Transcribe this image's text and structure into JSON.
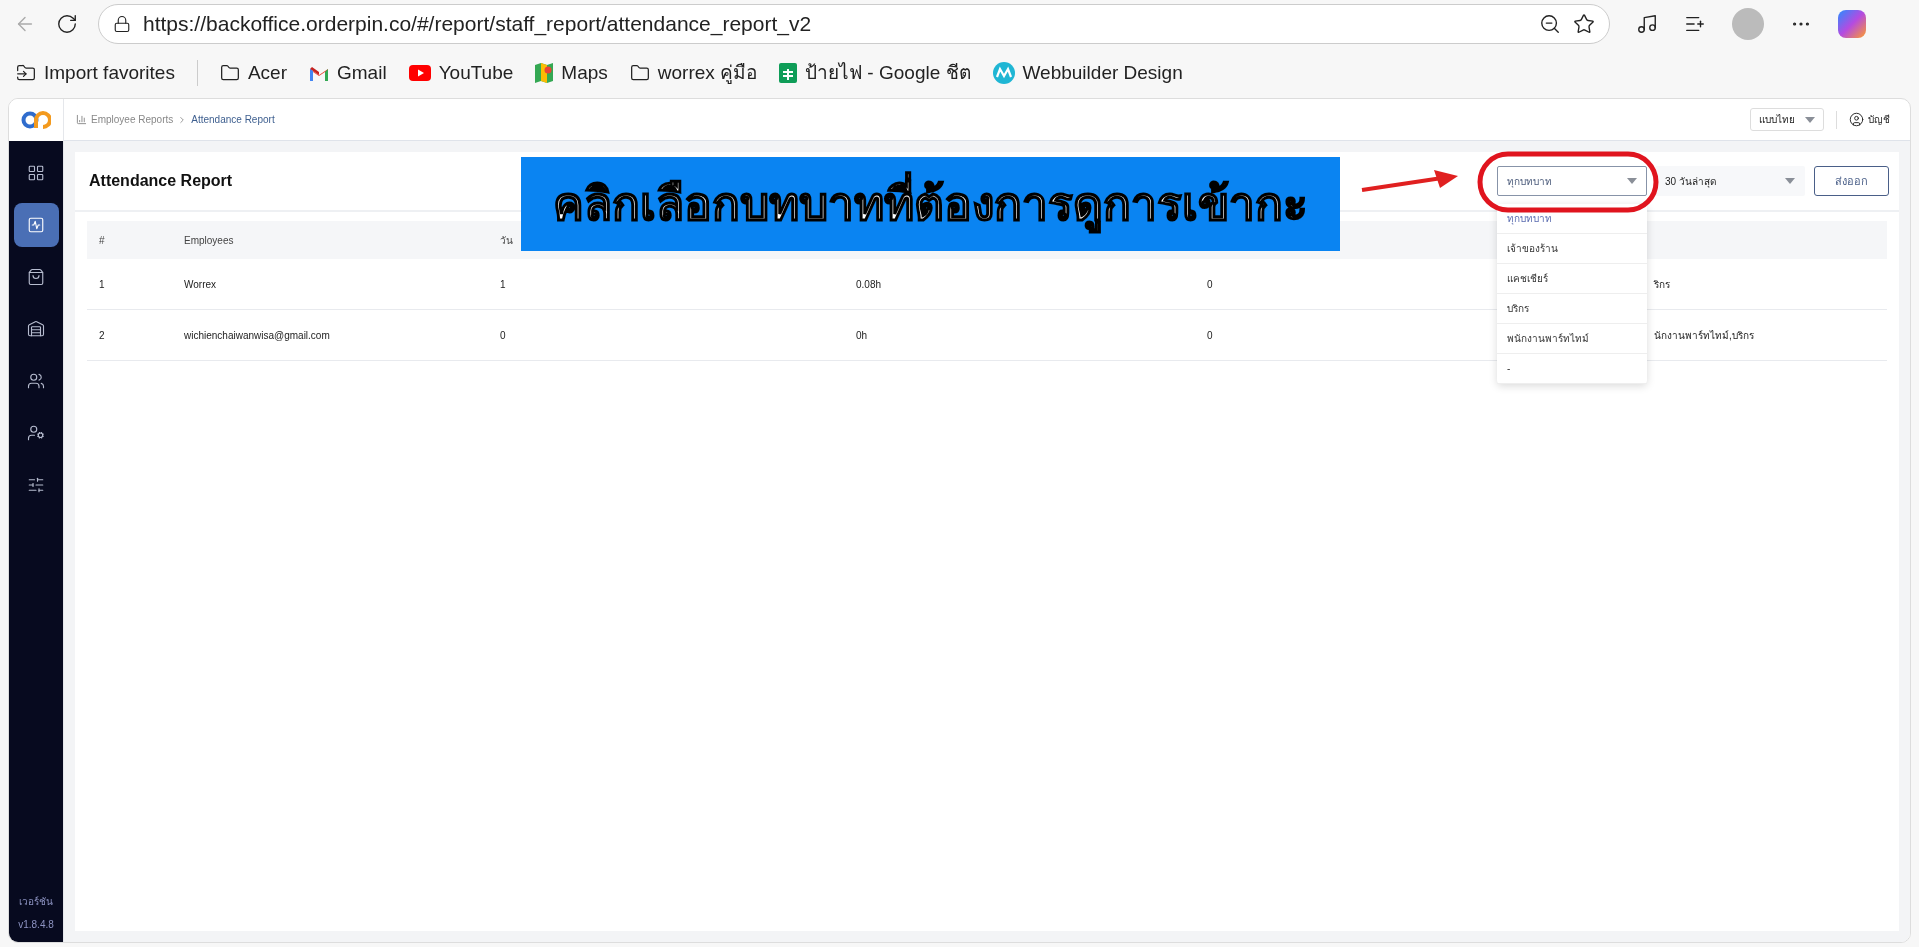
{
  "browser": {
    "url": "https://backoffice.orderpin.co/#/report/staff_report/attendance_report_v2",
    "bookmarks": [
      {
        "label": "Import favorites",
        "kind": "import"
      },
      {
        "label": "Acer",
        "kind": "folder"
      },
      {
        "label": "Gmail",
        "kind": "gmail"
      },
      {
        "label": "YouTube",
        "kind": "youtube"
      },
      {
        "label": "Maps",
        "kind": "maps"
      },
      {
        "label": "worrex คู่มือ",
        "kind": "folder"
      },
      {
        "label": "ป้ายไฟ - Google ชีต",
        "kind": "sheets"
      },
      {
        "label": "Webbuilder Design",
        "kind": "webbuilder"
      }
    ]
  },
  "sidebar": {
    "items": [
      {
        "kind": "grid",
        "selected": false
      },
      {
        "kind": "activity",
        "selected": true
      },
      {
        "kind": "bag",
        "selected": false
      },
      {
        "kind": "warehouse",
        "selected": false
      },
      {
        "kind": "users",
        "selected": false
      },
      {
        "kind": "user-settings",
        "selected": false
      },
      {
        "kind": "sliders",
        "selected": false
      }
    ],
    "version_label": "เวอร์ชัน",
    "version": "v1.8.4.8"
  },
  "breadcrumb": [
    "Employee Reports",
    "Attendance Report"
  ],
  "language_select": {
    "value": "แบบไทย"
  },
  "account": {
    "label": "บัญชี"
  },
  "page": {
    "title": "Attendance Report",
    "role_select": {
      "value": "ทุกบทบาท",
      "expanded": true,
      "options": [
        {
          "label": "ทุกบทบาท",
          "selected": true
        },
        {
          "label": "เจ้าของร้าน",
          "selected": false
        },
        {
          "label": "แคชเชียร์",
          "selected": false
        },
        {
          "label": "บริกร",
          "selected": false
        },
        {
          "label": "พนักงานพาร์ทไทม์",
          "selected": false
        },
        {
          "label": "-",
          "selected": false
        }
      ]
    },
    "period_select": {
      "value": "30 วันล่าสุด"
    },
    "export_button": "ส่งออก"
  },
  "table": {
    "columns": [
      "#",
      "Employees",
      "วัน"
    ],
    "rows": [
      [
        "1",
        "Worrex",
        "1",
        "0.08h",
        "0",
        "ริกร"
      ],
      [
        "2",
        "wichienchaiwanwisa@gmail.com",
        "0",
        "0h",
        "0",
        "นักงานพาร์ทไทม์,บริกร"
      ]
    ]
  },
  "annotation": {
    "text": "คลิกเลือกบทบาทที่ต้องการดูการเข้ากะ"
  }
}
